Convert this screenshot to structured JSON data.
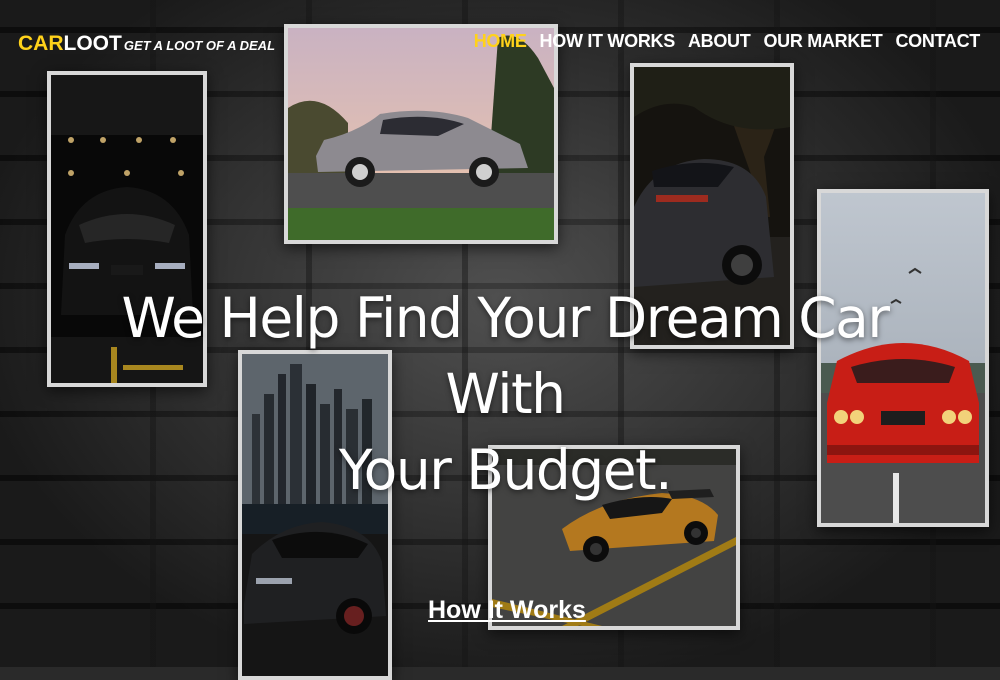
{
  "brand": {
    "name_part1": "CAR",
    "name_part2": "LOOT",
    "tagline": "GET A LOOT OF A DEAL"
  },
  "nav": {
    "items": [
      {
        "label": "HOME",
        "active": true
      },
      {
        "label": "HOW IT WORKS",
        "active": false
      },
      {
        "label": "ABOUT",
        "active": false
      },
      {
        "label": "OUR MARKET",
        "active": false
      },
      {
        "label": "CONTACT",
        "active": false
      }
    ]
  },
  "hero": {
    "headline_line1": "We Help Find Your Dream Car With",
    "headline_line2": "Your Budget.",
    "cta_label": "How It Works"
  },
  "colors": {
    "accent": "#ffd21a",
    "text": "#ffffff",
    "frame": "#d8d8d8"
  },
  "photos": [
    {
      "id": "black-bmw-garage"
    },
    {
      "id": "classic-silver-coupe-sunset"
    },
    {
      "id": "porsche-rear-forest"
    },
    {
      "id": "red-bmw-m3"
    },
    {
      "id": "black-mercedes-skyline"
    },
    {
      "id": "orange-lamborghini-parking"
    }
  ]
}
